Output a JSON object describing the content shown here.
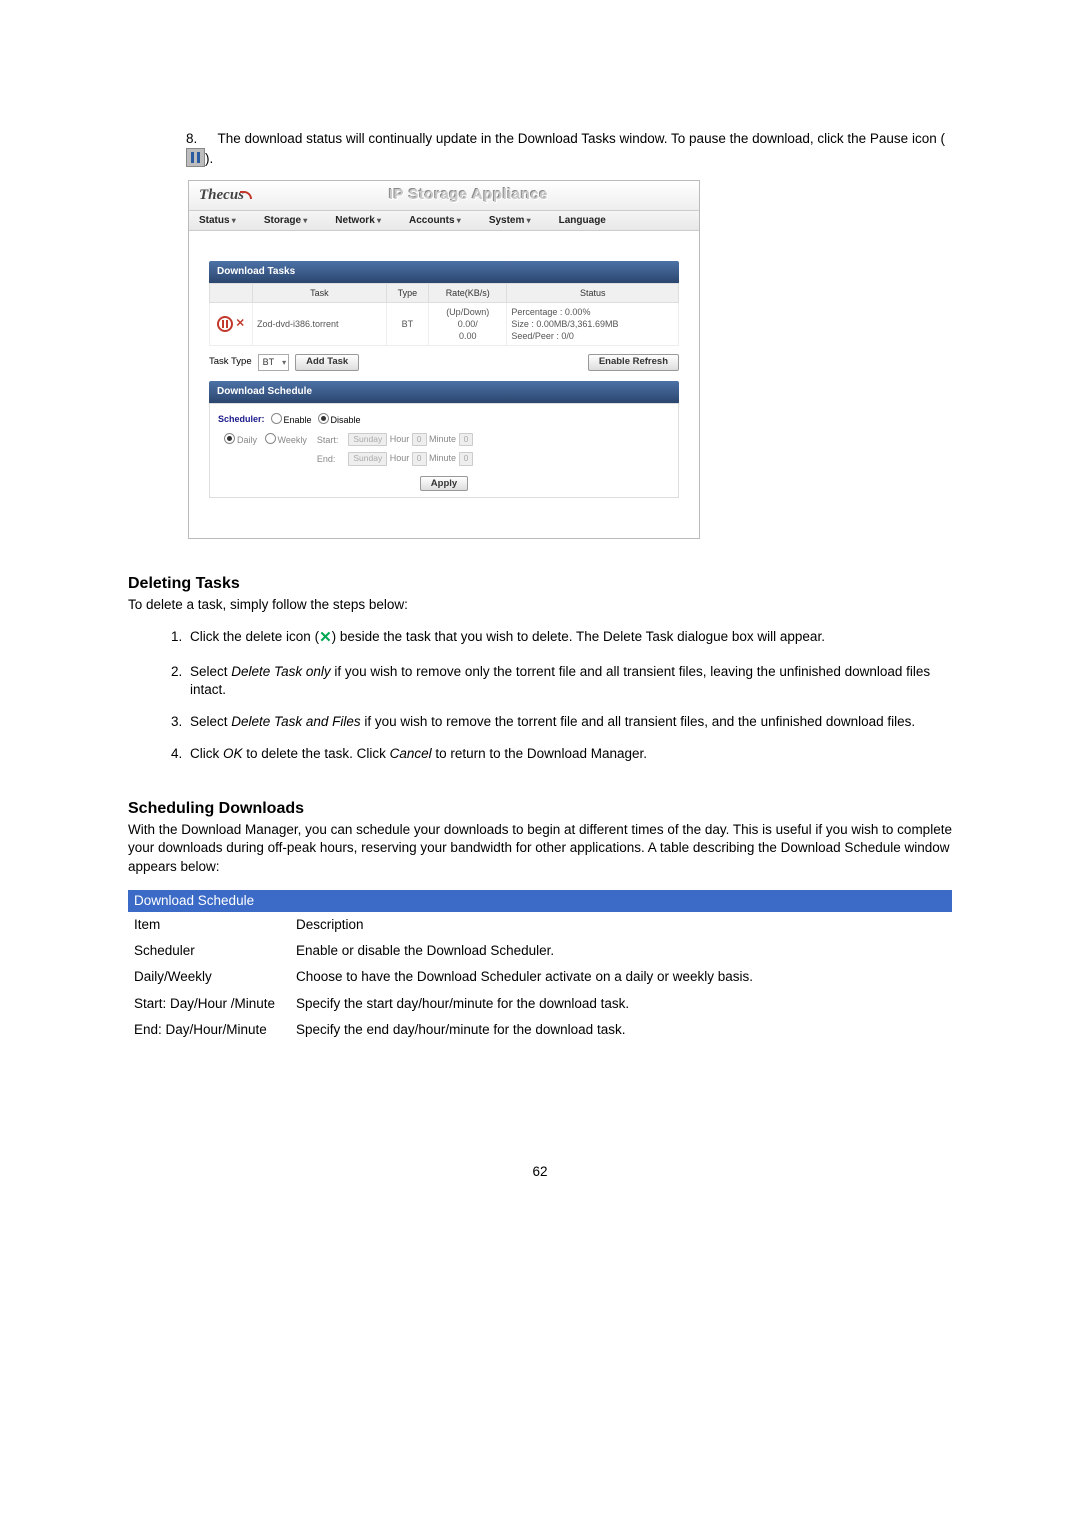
{
  "intro": {
    "item8_a": "The download status will continually update in the Download Tasks window. To pause the download, click the Pause icon (",
    "item8_b": ")."
  },
  "screenshot": {
    "brand": "Thecus",
    "title": "IP Storage Appliance",
    "menu": [
      "Status",
      "Storage",
      "Network",
      "Accounts",
      "System",
      "Language"
    ],
    "tasks_header": "Download Tasks",
    "th": {
      "task": "Task",
      "type": "Type",
      "rate": "Rate(KB/s)",
      "status": "Status"
    },
    "row": {
      "task": "Zod-dvd-i386.torrent",
      "type": "BT",
      "rate": "(Up/Down)\n0.00/\n0.00",
      "status": "Percentage : 0.00%\nSize : 0.00MB/3,361.69MB\nSeed/Peer : 0/0"
    },
    "task_type_label": "Task Type",
    "task_type_value": "BT",
    "add_task": "Add Task",
    "enable_refresh": "Enable Refresh",
    "sched_header": "Download Schedule",
    "scheduler_label": "Scheduler:",
    "enable": "Enable",
    "disable": "Disable",
    "daily": "Daily",
    "weekly": "Weekly",
    "start": "Start:",
    "end": "End:",
    "hour": "Hour",
    "minute": "Minute",
    "sunday": "Sunday",
    "apply": "Apply"
  },
  "deleting": {
    "heading": "Deleting Tasks",
    "lead": "To delete a task, simply follow the steps below:",
    "step1_a": "Click the delete icon (",
    "step1_b": ") beside the task that you wish to delete. The Delete Task dialogue box will appear.",
    "step2_a": "Select ",
    "step2_em": "Delete Task only",
    "step2_b": " if you wish to remove only the torrent file and all transient files, leaving the unfinished download files intact.",
    "step3_a": "Select ",
    "step3_em": "Delete Task and Files",
    "step3_b": " if you wish to remove the torrent file and all transient files, and the unfinished download files.",
    "step4_a": "Click ",
    "step4_ok": "OK",
    "step4_b": " to delete the task. Click ",
    "step4_cancel": "Cancel",
    "step4_c": " to return to the Download Manager."
  },
  "scheduling": {
    "heading": "Scheduling Downloads",
    "lead": "With the Download Manager, you can schedule your downloads to begin at different times of the day. This is useful if you wish to complete your downloads during off-peak hours, reserving your bandwidth for other applications. A table describing the Download Schedule window appears below:",
    "table_title": "Download Schedule",
    "th_item": "Item",
    "th_desc": "Description",
    "rows": [
      {
        "item": "Scheduler",
        "desc": "Enable or disable the Download Scheduler."
      },
      {
        "item": "Daily/Weekly",
        "desc": "Choose to have the Download Scheduler activate on a daily or weekly basis."
      },
      {
        "item": "Start: Day/Hour /Minute",
        "desc": "Specify the start day/hour/minute for the download task."
      },
      {
        "item": "End: Day/Hour/Minute",
        "desc": "Specify the end day/hour/minute for the download task."
      }
    ]
  },
  "page_number": "62"
}
